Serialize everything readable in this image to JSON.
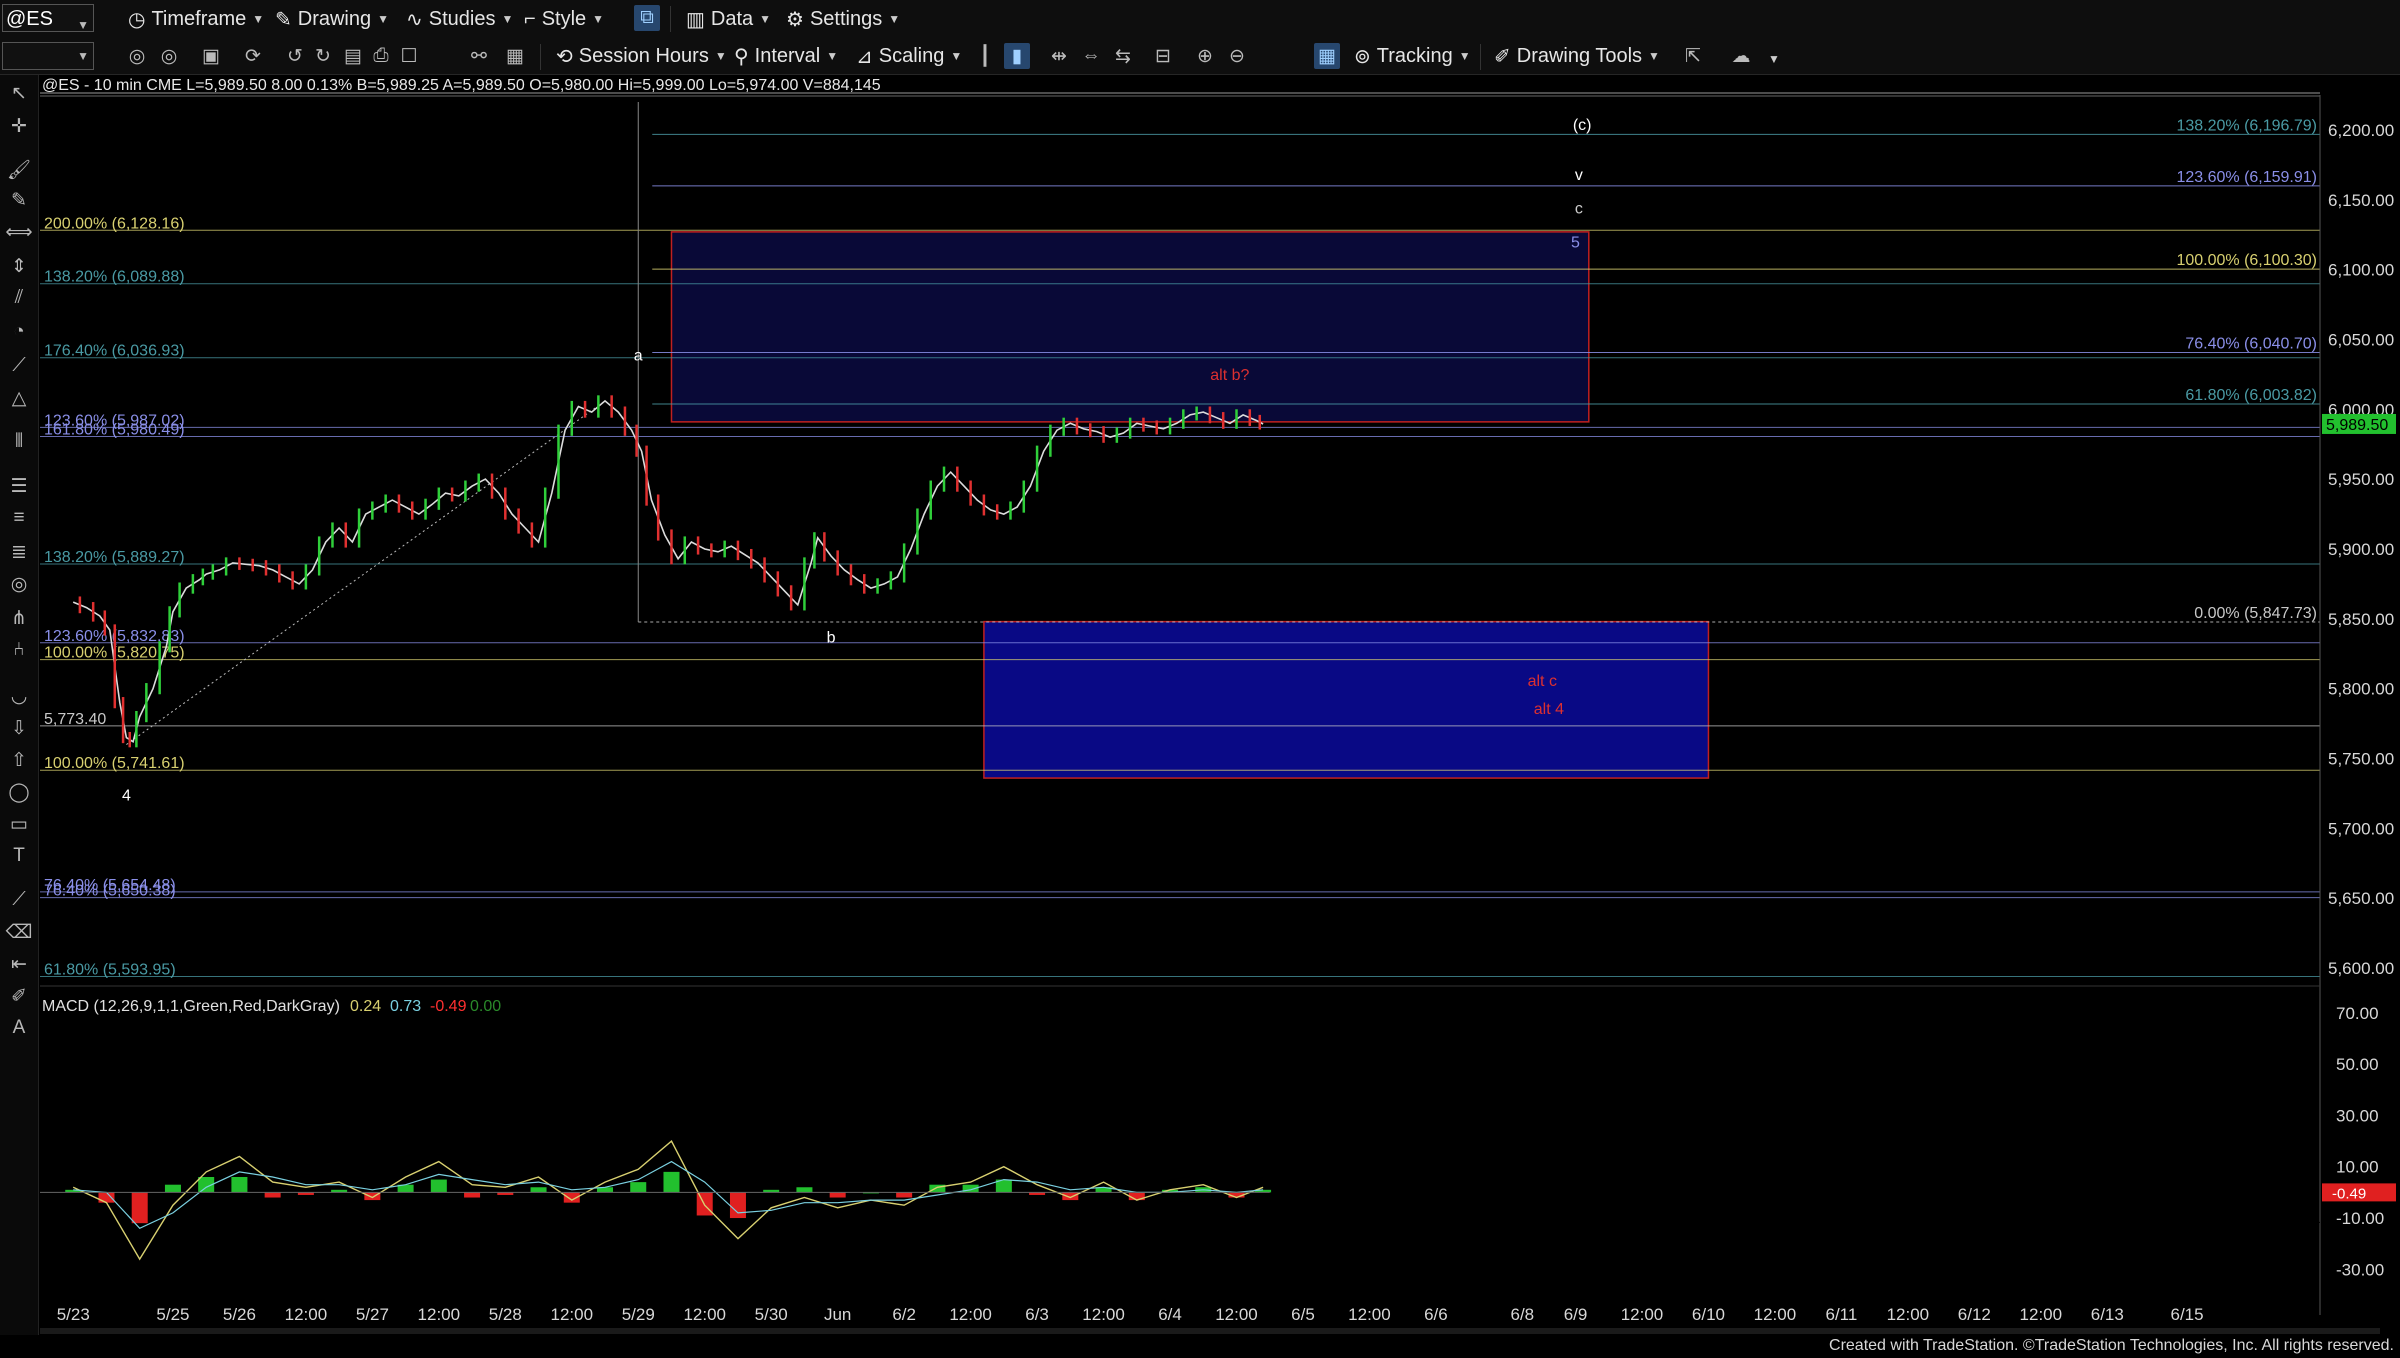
{
  "toolbar1": {
    "symbol": "@ES",
    "timeframe": "Timeframe",
    "drawing": "Drawing",
    "studies": "Studies",
    "style": "Style",
    "data": "Data",
    "settings": "Settings"
  },
  "toolbar2": {
    "session_hours": "Session Hours",
    "interval": "Interval",
    "scaling": "Scaling",
    "tracking": "Tracking",
    "drawing_tools": "Drawing Tools"
  },
  "header_line": "@ES - 10 min  CME   L=5,989.50  8.00  0.13%  B=5,989.25  A=5,989.50  O=5,980.00  Hi=5,999.00  Lo=5,974.00  V=884,145",
  "credit": "Created with TradeStation. ©TradeStation Technologies, Inc. All rights reserved.",
  "chart_data": {
    "type": "line",
    "price_axis": {
      "min": 5590,
      "max": 6225,
      "ticks": [
        "6,200.00",
        "6,150.00",
        "6,100.00",
        "6,050.00",
        "6,000.00",
        "5,950.00",
        "5,900.00",
        "5,850.00",
        "5,800.00",
        "5,750.00",
        "5,700.00",
        "5,650.00",
        "5,600.00"
      ],
      "tick_values": [
        6200,
        6150,
        6100,
        6050,
        6000,
        5950,
        5900,
        5850,
        5800,
        5750,
        5700,
        5650,
        5600
      ],
      "last_price_label": "5,989.50",
      "last_price": 5989.5
    },
    "time_axis": {
      "labels": [
        "5/23",
        "5/25",
        "5/26",
        "12:00",
        "5/27",
        "12:00",
        "5/28",
        "12:00",
        "5/29",
        "12:00",
        "5/30",
        "Jun",
        "6/2",
        "12:00",
        "6/3",
        "12:00",
        "6/4",
        "12:00",
        "6/5",
        "12:00",
        "6/6",
        "6/8",
        "6/9",
        "12:00",
        "6/10",
        "12:00",
        "6/11",
        "12:00",
        "6/12",
        "12:00",
        "6/13",
        "6/15"
      ],
      "positions": [
        0,
        1.5,
        2.5,
        3.5,
        4.5,
        5.5,
        6.5,
        7.5,
        8.5,
        9.5,
        10.5,
        11.5,
        12.5,
        13.5,
        14.5,
        15.5,
        16.5,
        17.5,
        18.5,
        19.5,
        20.5,
        21.8,
        22.6,
        23.6,
        24.6,
        25.6,
        26.6,
        27.6,
        28.6,
        29.6,
        30.6,
        31.8
      ],
      "axis_range": [
        -0.5,
        33.8
      ]
    },
    "series": [
      {
        "x": [
          0,
          0.2,
          0.4,
          0.55,
          0.7,
          0.8,
          0.9,
          1.0,
          1.2,
          1.4,
          1.5,
          1.7,
          1.9,
          2.0,
          2.2,
          2.4,
          2.6,
          2.8,
          3.0,
          3.2,
          3.4,
          3.6,
          3.8,
          4.0,
          4.2,
          4.4,
          4.6,
          4.8,
          5.0,
          5.2,
          5.4,
          5.6,
          5.8,
          6.0,
          6.2,
          6.4,
          6.6,
          6.8,
          7.0,
          7.2,
          7.4,
          7.6,
          7.8,
          8.0,
          8.2,
          8.4,
          8.55,
          8.7,
          8.9,
          9.1,
          9.3,
          9.5,
          9.7,
          9.9,
          10.1,
          10.3,
          10.5,
          10.7,
          10.9,
          11.1,
          11.2,
          11.4,
          11.6,
          11.8,
          12.0,
          12.2,
          12.4,
          12.6,
          12.8,
          13.0,
          13.2,
          13.4,
          13.6,
          13.8,
          14.0,
          14.2,
          14.4,
          14.6,
          14.8,
          15.0,
          15.2,
          15.4,
          15.6,
          15.8,
          16.0,
          16.2,
          16.4,
          16.6,
          16.8,
          17.0,
          17.2,
          17.4,
          17.6,
          17.8,
          17.9
        ],
        "y": [
          5862,
          5858,
          5852,
          5842,
          5790,
          5765,
          5762,
          5780,
          5800,
          5830,
          5855,
          5872,
          5878,
          5882,
          5885,
          5890,
          5889,
          5888,
          5885,
          5880,
          5875,
          5885,
          5905,
          5915,
          5905,
          5925,
          5930,
          5935,
          5930,
          5925,
          5932,
          5940,
          5938,
          5945,
          5950,
          5940,
          5925,
          5915,
          5905,
          5940,
          5985,
          6002,
          5998,
          6006,
          5998,
          5985,
          5970,
          5935,
          5910,
          5893,
          5905,
          5900,
          5898,
          5902,
          5896,
          5890,
          5880,
          5870,
          5860,
          5890,
          5908,
          5895,
          5885,
          5878,
          5872,
          5875,
          5880,
          5900,
          5925,
          5945,
          5955,
          5945,
          5935,
          5928,
          5925,
          5930,
          5945,
          5970,
          5985,
          5990,
          5986,
          5984,
          5980,
          5983,
          5990,
          5988,
          5986,
          5990,
          5996,
          5998,
          5994,
          5990,
          5996,
          5992,
          5989.5
        ]
      }
    ],
    "fib_labels": [
      {
        "text": "200.00% (6,128.16)",
        "value": 6128.16,
        "side": "left",
        "color": "#d8d070"
      },
      {
        "text": "138.20% (6,089.88)",
        "value": 6089.88,
        "side": "left",
        "color": "#4a9aa4"
      },
      {
        "text": "176.40% (6,036.93)",
        "value": 6036.93,
        "side": "left",
        "color": "#4a9aa4"
      },
      {
        "text": "123.60% (5,987.02)",
        "value": 5987.02,
        "side": "left",
        "color": "#8a8fe8"
      },
      {
        "text": "161.80% (5,980.49)",
        "value": 5980.49,
        "side": "left",
        "color": "#8a8fe8"
      },
      {
        "text": "138.20% (5,889.27)",
        "value": 5889.27,
        "side": "left",
        "color": "#4a9aa4"
      },
      {
        "text": "123.60% (5,832.83)",
        "value": 5832.83,
        "side": "left",
        "color": "#8a8fe8"
      },
      {
        "text": "100.00% (5,820.75)",
        "value": 5820.75,
        "side": "left",
        "color": "#d8d070"
      },
      {
        "text": "5,773.40",
        "value": 5773.4,
        "side": "left",
        "color": "#c8c8c8"
      },
      {
        "text": "100.00% (5,741.61)",
        "value": 5741.61,
        "side": "left",
        "color": "#d8d070"
      },
      {
        "text": "76.40% (5,654.48)",
        "value": 5654.48,
        "side": "left",
        "color": "#8a8fe8"
      },
      {
        "text": "76.40% (5,650.38)",
        "value": 5650.38,
        "side": "left",
        "color": "#8a8fe8"
      },
      {
        "text": "61.80% (5,593.95)",
        "value": 5593.95,
        "side": "left",
        "color": "#4a9aa4"
      },
      {
        "text": "138.20% (6,196.79)",
        "value": 6196.79,
        "side": "right",
        "color": "#4a9aa4"
      },
      {
        "text": "123.60% (6,159.91)",
        "value": 6159.91,
        "side": "right",
        "color": "#8a8fe8"
      },
      {
        "text": "100.00% (6,100.30)",
        "value": 6100.3,
        "side": "right",
        "color": "#d8d070"
      },
      {
        "text": "76.40% (6,040.70)",
        "value": 6040.7,
        "side": "right",
        "color": "#8a8fe8"
      },
      {
        "text": "61.80% (6,003.82)",
        "value": 6003.82,
        "side": "right",
        "color": "#4a9aa4"
      },
      {
        "text": "0.00% (5,847.73)",
        "value": 5847.73,
        "side": "right",
        "color": "#c8c8c8"
      }
    ],
    "wave_labels": [
      {
        "text": "a",
        "x": 8.5,
        "y": 6035,
        "color": "#ffffff"
      },
      {
        "text": "b",
        "x": 11.4,
        "y": 5833,
        "color": "#ffffff"
      },
      {
        "text": "4",
        "x": 0.8,
        "y": 5720,
        "color": "#ffffff"
      },
      {
        "text": "(c)",
        "x": 22.7,
        "y": 6200,
        "color": "#ffffff"
      },
      {
        "text": "v",
        "x": 22.65,
        "y": 6164,
        "color": "#ffffff"
      },
      {
        "text": "c",
        "x": 22.65,
        "y": 6140,
        "color": "#cccccc"
      },
      {
        "text": "5",
        "x": 22.6,
        "y": 6116,
        "color": "#8a8fe8"
      },
      {
        "text": "alt b?",
        "x": 17.4,
        "y": 6021,
        "color": "#dd3030"
      },
      {
        "text": "alt c",
        "x": 22.1,
        "y": 5802,
        "color": "#dd3030"
      },
      {
        "text": "alt 4",
        "x": 22.2,
        "y": 5782,
        "color": "#dd3030"
      }
    ],
    "boxes": [
      {
        "x1": 9.0,
        "x2": 22.8,
        "y1": 5991,
        "y2": 6127,
        "fill": "#0a0a3a",
        "stroke": "#c02020"
      },
      {
        "x1": 13.7,
        "x2": 24.6,
        "y1": 5736,
        "y2": 5848,
        "fill": "#0a0a8c",
        "stroke": "#c02020"
      }
    ],
    "macd": {
      "label": "MACD (12,26,9,1,1,Green,Red,DarkGray)",
      "values_text": [
        "0.24",
        "0.73",
        "-0.49",
        "0.00"
      ],
      "values_colors": [
        "#d8d070",
        "#7ad0e0",
        "#ff3030",
        "#2a8a2a"
      ],
      "axis_ticks": [
        "70.00",
        "50.00",
        "30.00",
        "10.00",
        "-10.00",
        "-30.00"
      ],
      "axis_values": [
        70,
        50,
        30,
        10,
        -10,
        -30
      ],
      "min": -40,
      "max": 75,
      "last_label": "-0.49",
      "x": [
        0,
        0.5,
        1.0,
        1.5,
        2.0,
        2.5,
        3.0,
        3.5,
        4.0,
        4.5,
        5.0,
        5.5,
        6.0,
        6.5,
        7.0,
        7.5,
        8.0,
        8.5,
        9.0,
        9.5,
        10.0,
        10.5,
        11.0,
        11.5,
        12.0,
        12.5,
        13.0,
        13.5,
        14.0,
        14.5,
        15.0,
        15.5,
        16.0,
        16.5,
        17.0,
        17.5,
        17.9
      ],
      "macd_line": [
        2,
        -4,
        -26,
        -5,
        8,
        14,
        4,
        2,
        4,
        -2,
        6,
        12,
        3,
        2,
        6,
        -3,
        4,
        9,
        20,
        -5,
        -18,
        -6,
        -2,
        -6,
        -3,
        -5,
        2,
        4,
        10,
        3,
        -2,
        4,
        -3,
        1,
        3,
        -2,
        2
      ],
      "signal_line": [
        1,
        0,
        -14,
        -8,
        2,
        8,
        6,
        3,
        3,
        1,
        3,
        7,
        5,
        3,
        4,
        1,
        2,
        5,
        12,
        4,
        -8,
        -7,
        -4,
        -4,
        -3,
        -3,
        -1,
        1,
        5,
        4,
        1,
        2,
        0,
        0,
        1,
        0,
        1
      ]
    }
  }
}
